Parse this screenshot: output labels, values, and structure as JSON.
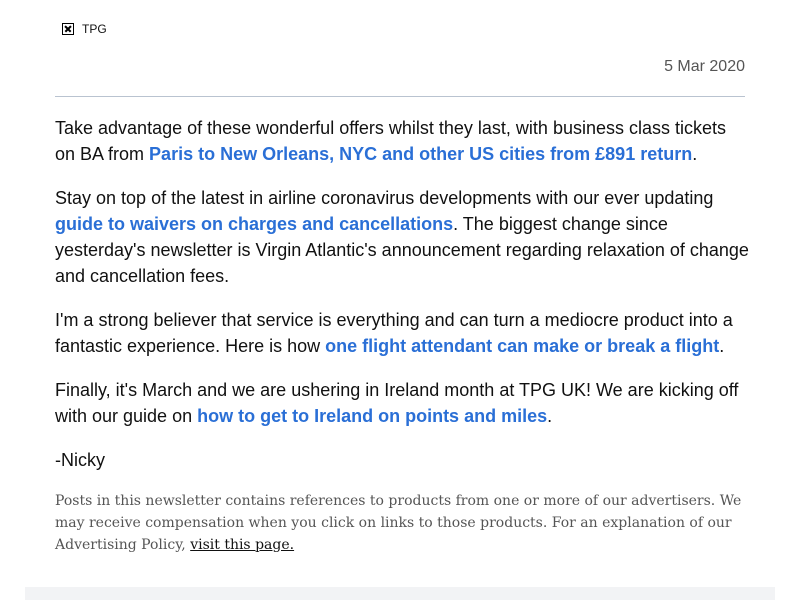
{
  "header": {
    "logo_alt": "TPG",
    "date": "5 Mar 2020"
  },
  "paragraphs": [
    {
      "before": "Take advantage of these wonderful offers whilst they last, with business class tickets on BA from ",
      "link": "Paris to New Orleans, NYC and other US cities from £891 return",
      "after": "."
    },
    {
      "before": "Stay on top of the latest in airline coronavirus developments with our ever updating ",
      "link": "guide to waivers on charges and cancellations",
      "after": ". The biggest change since yesterday's newsletter is Virgin Atlantic's announcement regarding relaxation of change and cancellation fees."
    },
    {
      "before": "I'm a strong believer that service is everything and can turn a mediocre product into a fantastic experience. Here is how ",
      "link": "one flight attendant can make or break a flight",
      "after": "."
    },
    {
      "before": "Finally, it's March and we are ushering in Ireland month at TPG UK! We are kicking off with our guide on ",
      "link": "how to get to Ireland on points and miles",
      "after": "."
    }
  ],
  "signature": "-Nicky",
  "disclaimer": {
    "text": "Posts in this newsletter contains references to products from one or more of our advertisers. We may receive compensation when you click on links to those products. For an explanation of our Advertising Policy, ",
    "link": "visit this page."
  },
  "colors": {
    "link": "#2a6fd6",
    "body_text": "#111111",
    "muted_text": "#555555",
    "divider": "#b9c3d0"
  }
}
